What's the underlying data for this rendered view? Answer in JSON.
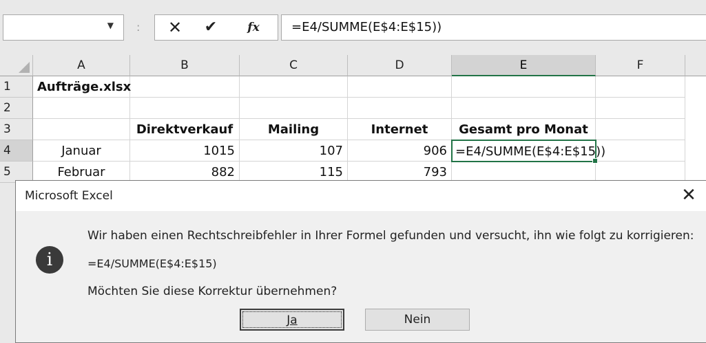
{
  "formula_bar": {
    "name_box_value": "",
    "name_box_dropdown_icon": "chevron-down-icon",
    "separator": ":",
    "cancel_icon": "close-icon",
    "enter_icon": "check-icon",
    "function_icon": "fx-icon",
    "cancel_glyph": "✕",
    "enter_glyph": "✔",
    "fx_label": "fx",
    "formula": "=E4/SUMME(E$4:E$15))"
  },
  "sheet": {
    "columns": [
      "A",
      "B",
      "C",
      "D",
      "E",
      "F"
    ],
    "selected_column": "E",
    "rows": [
      {
        "num": "1",
        "cells": [
          "Aufträge.xlsx",
          "",
          "",
          "",
          "",
          ""
        ]
      },
      {
        "num": "2",
        "cells": [
          "",
          "",
          "",
          "",
          "",
          ""
        ]
      },
      {
        "num": "3",
        "cells": [
          "",
          "Direktverkauf",
          "Mailing",
          "Internet",
          "Gesamt pro Monat",
          ""
        ]
      },
      {
        "num": "4",
        "cells": [
          "Januar",
          "1015",
          "107",
          "906",
          "=E4/SUMME(E$4:E$15))",
          ""
        ]
      },
      {
        "num": "5",
        "cells": [
          "Februar",
          "882",
          "115",
          "793",
          "",
          ""
        ]
      }
    ],
    "active_cell": "E4"
  },
  "dialog": {
    "title": "Microsoft Excel",
    "close_icon": "close-icon",
    "close_glyph": "✕",
    "info_icon": "info-icon",
    "info_glyph": "i",
    "message": "Wir haben einen Rechtschreibfehler in Ihrer Formel gefunden und versucht, ihn wie folgt zu korrigieren:",
    "corrected_formula": "=E4/SUMME(E$4:E$15)",
    "question": "Möchten Sie diese Korrektur übernehmen?",
    "yes_label": "Ja",
    "no_label": "Nein"
  }
}
